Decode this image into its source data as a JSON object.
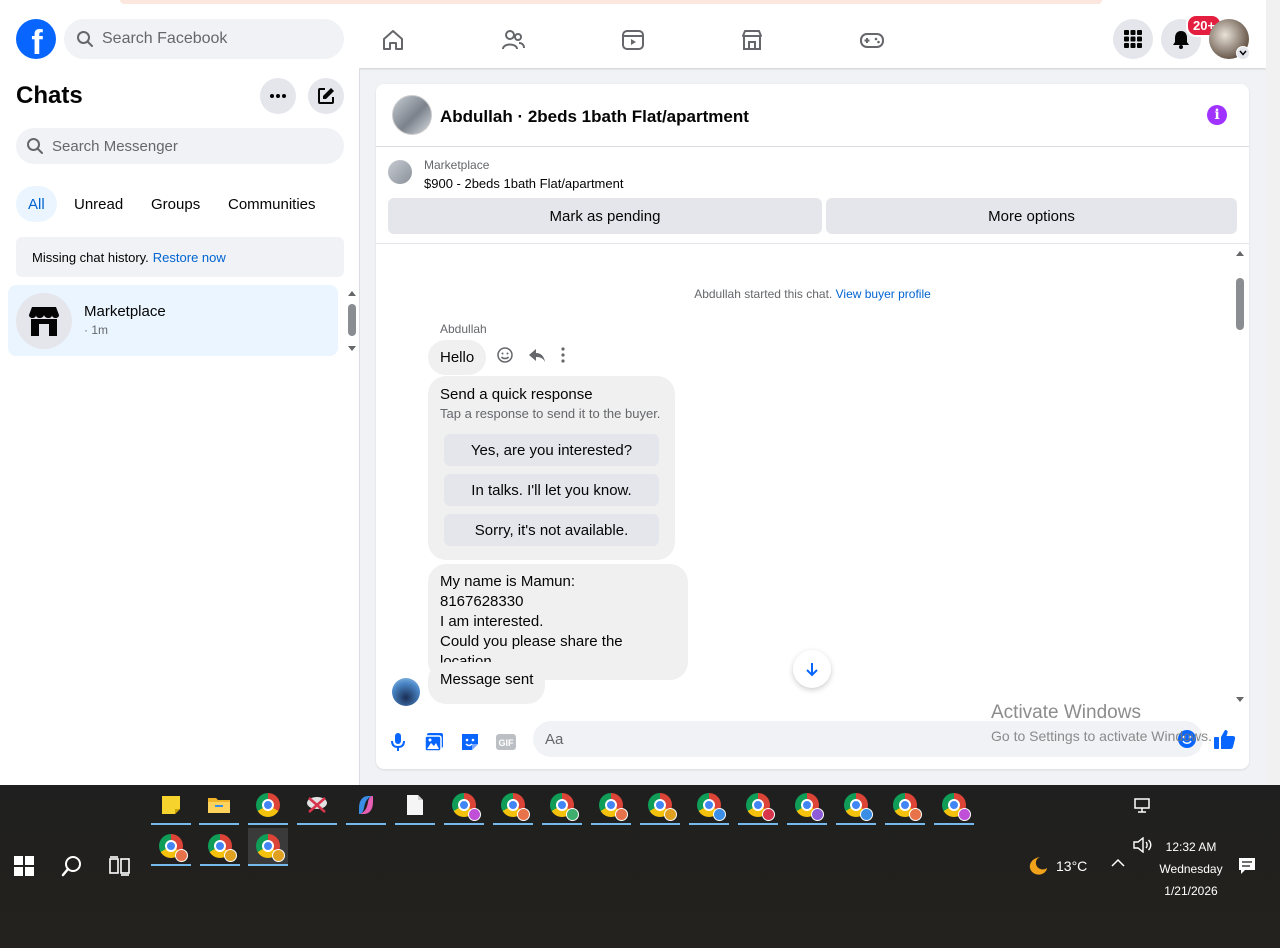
{
  "topbar": {
    "search_placeholder": "Search Facebook",
    "notification_badge": "20+",
    "nav_icons": [
      "home-icon",
      "friends-icon",
      "watch-icon",
      "marketplace-icon",
      "gaming-icon"
    ]
  },
  "chats": {
    "title": "Chats",
    "search_placeholder": "Search Messenger",
    "filters": [
      "All",
      "Unread",
      "Groups",
      "Communities"
    ],
    "active_filter": "All",
    "restore_text": "Missing chat history.",
    "restore_link": "Restore now",
    "items": [
      {
        "name": "Marketplace",
        "time": "· 1m"
      }
    ]
  },
  "conversation": {
    "title": "Abdullah · 2beds 1bath Flat/apartment",
    "marketplace_label": "Marketplace",
    "listing": "$900 - 2beds 1bath Flat/apartment",
    "mark_pending_label": "Mark as pending",
    "more_options_label": "More options",
    "started_text": "Abdullah started this chat.",
    "view_buyer_link": "View buyer profile",
    "sender_name": "Abdullah",
    "hello_message": "Hello",
    "quick_response": {
      "title": "Send a quick response",
      "subtitle": "Tap a response to send it to the buyer.",
      "options": [
        "Yes, are you interested?",
        "In talks. I'll let you know.",
        "Sorry, it's not available."
      ]
    },
    "message_lines": [
      "My name is Mamun:",
      "8167628330",
      "I am interested.",
      "Could you please share the location"
    ],
    "sent_status": "Message sent",
    "composer_placeholder": "Aa"
  },
  "watermark": {
    "line1": "Activate Windows",
    "line2": "Go to Settings to activate Windows."
  },
  "taskbar": {
    "temperature": "13°C",
    "time": "12:32 AM",
    "day": "Wednesday",
    "date": "1/21/2026",
    "profile_colors": [
      "#c04fd8",
      "#e8734a",
      "#3fae6e",
      "#e8734a",
      "#e0a020",
      "#3a8ee6",
      "#d8344c",
      "#8e5cd8",
      "#3a8ee6",
      "#e8734a",
      "#c04fd8",
      "#e8734a",
      "#e0a020"
    ]
  },
  "colors": {
    "brand": "#0866ff",
    "link": "#0064d1",
    "badge": "#e41e3f",
    "info": "#a033ff"
  }
}
